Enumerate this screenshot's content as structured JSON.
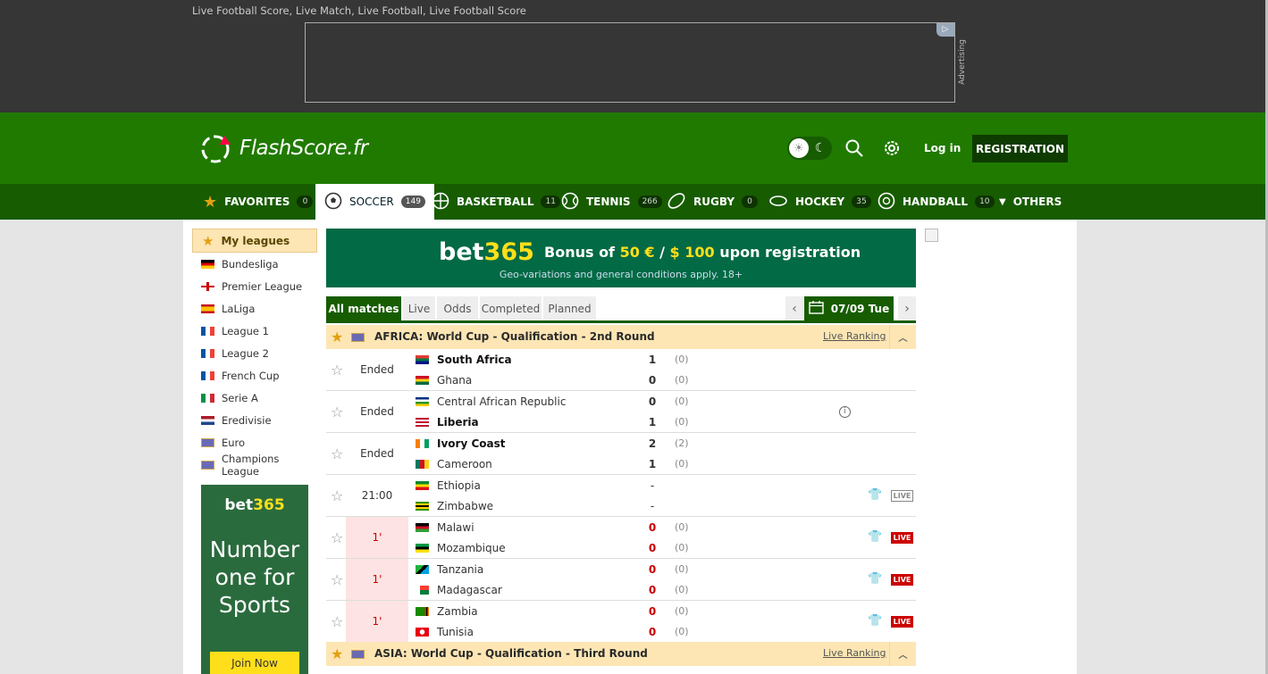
{
  "topbar": {
    "seo_text": "Live Football Score, Live Match, Live Football, Live Football Score",
    "ad_badge": "▷",
    "ad_label": "Advertising"
  },
  "header": {
    "logo_text": "FlashScore.fr",
    "login": "Log in",
    "register": "REGISTRATION"
  },
  "nav": [
    {
      "label": "FAVORITES",
      "count": "0",
      "icon": "star-icon"
    },
    {
      "label": "SOCCER",
      "count": "149",
      "icon": "soccer-ball-icon"
    },
    {
      "label": "BASKETBALL",
      "count": "11",
      "icon": "basketball-icon"
    },
    {
      "label": "TENNIS",
      "count": "266",
      "icon": "tennis-ball-icon"
    },
    {
      "label": "RUGBY",
      "count": "0",
      "icon": "rugby-ball-icon"
    },
    {
      "label": "HOCKEY",
      "count": "35",
      "icon": "hockey-puck-icon"
    },
    {
      "label": "HANDBALL",
      "count": "10",
      "icon": "handball-icon"
    },
    {
      "label": "OTHERS",
      "count": "",
      "icon": "caret-down-icon"
    }
  ],
  "sidebar": {
    "title": "My leagues",
    "leagues": [
      {
        "name": "Bundesliga",
        "flag": "germany"
      },
      {
        "name": "Premier League",
        "flag": "england"
      },
      {
        "name": "LaLiga",
        "flag": "spain"
      },
      {
        "name": "League 1",
        "flag": "france"
      },
      {
        "name": "League 2",
        "flag": "france"
      },
      {
        "name": "French Cup",
        "flag": "france"
      },
      {
        "name": "Serie A",
        "flag": "italy"
      },
      {
        "name": "Eredivisie",
        "flag": "netherlands"
      },
      {
        "name": "Euro",
        "flag": "europe"
      },
      {
        "name": "Champions League",
        "flag": "europe"
      }
    ],
    "ad": {
      "brand_a": "bet",
      "brand_b": "365",
      "slogan": "Number one for Sports",
      "cta": "Join Now"
    }
  },
  "banner": {
    "brand_a": "bet",
    "brand_b": "365",
    "bonus_prefix": "Bonus of ",
    "bonus_a": "50 €",
    "bonus_sep": " / ",
    "bonus_b": "$ 100",
    "bonus_suffix": " upon registration",
    "conditions": "Geo-variations and general conditions apply. 18+"
  },
  "tabs": [
    "All matches",
    "Live",
    "Odds",
    "Completed",
    "Planned"
  ],
  "date": "07/09 Tue",
  "leagues": [
    {
      "name": "AFRICA: World Cup - Qualification - 2nd Round",
      "ranking": "Live Ranking"
    },
    {
      "name": "ASIA: World Cup - Qualification - Third Round",
      "ranking": "Live Ranking"
    }
  ],
  "matches": [
    {
      "stage": "Ended",
      "live": false,
      "home": "South Africa",
      "away": "Ghana",
      "hs": "1",
      "as": "0",
      "hht": "(0)",
      "aht": "(0)",
      "home_bold": true,
      "away_bold": false,
      "info": false,
      "badge": ""
    },
    {
      "stage": "Ended",
      "live": false,
      "home": "Central African Republic",
      "away": "Liberia",
      "hs": "0",
      "as": "1",
      "hht": "(0)",
      "aht": "(0)",
      "home_bold": false,
      "away_bold": true,
      "info": true,
      "badge": ""
    },
    {
      "stage": "Ended",
      "live": false,
      "home": "Ivory Coast",
      "away": "Cameroon",
      "hs": "2",
      "as": "1",
      "hht": "(2)",
      "aht": "(0)",
      "home_bold": true,
      "away_bold": false,
      "info": false,
      "badge": ""
    },
    {
      "stage": "21:00",
      "live": false,
      "home": "Ethiopia",
      "away": "Zimbabwe",
      "hs": "-",
      "as": "-",
      "hht": "",
      "aht": "",
      "home_bold": false,
      "away_bold": false,
      "info": false,
      "badge": "LIVE"
    },
    {
      "stage": "1'",
      "live": true,
      "home": "Malawi",
      "away": "Mozambique",
      "hs": "0",
      "as": "0",
      "hht": "(0)",
      "aht": "(0)",
      "home_bold": false,
      "away_bold": false,
      "info": false,
      "badge": "LIVE"
    },
    {
      "stage": "1'",
      "live": true,
      "home": "Tanzania",
      "away": "Madagascar",
      "hs": "0",
      "as": "0",
      "hht": "(0)",
      "aht": "(0)",
      "home_bold": false,
      "away_bold": false,
      "info": false,
      "badge": "LIVE"
    },
    {
      "stage": "1'",
      "live": true,
      "home": "Zambia",
      "away": "Tunisia",
      "hs": "0",
      "as": "0",
      "hht": "(0)",
      "aht": "(0)",
      "home_bold": false,
      "away_bold": false,
      "info": false,
      "badge": "LIVE"
    }
  ],
  "colors": {
    "brand_green": "#207a00",
    "nav_green": "#175c00",
    "league_bg": "#fde6b4",
    "live_red": "#c00000",
    "bet365_green": "#026a45",
    "bet365_yellow": "#ffdf1b"
  }
}
